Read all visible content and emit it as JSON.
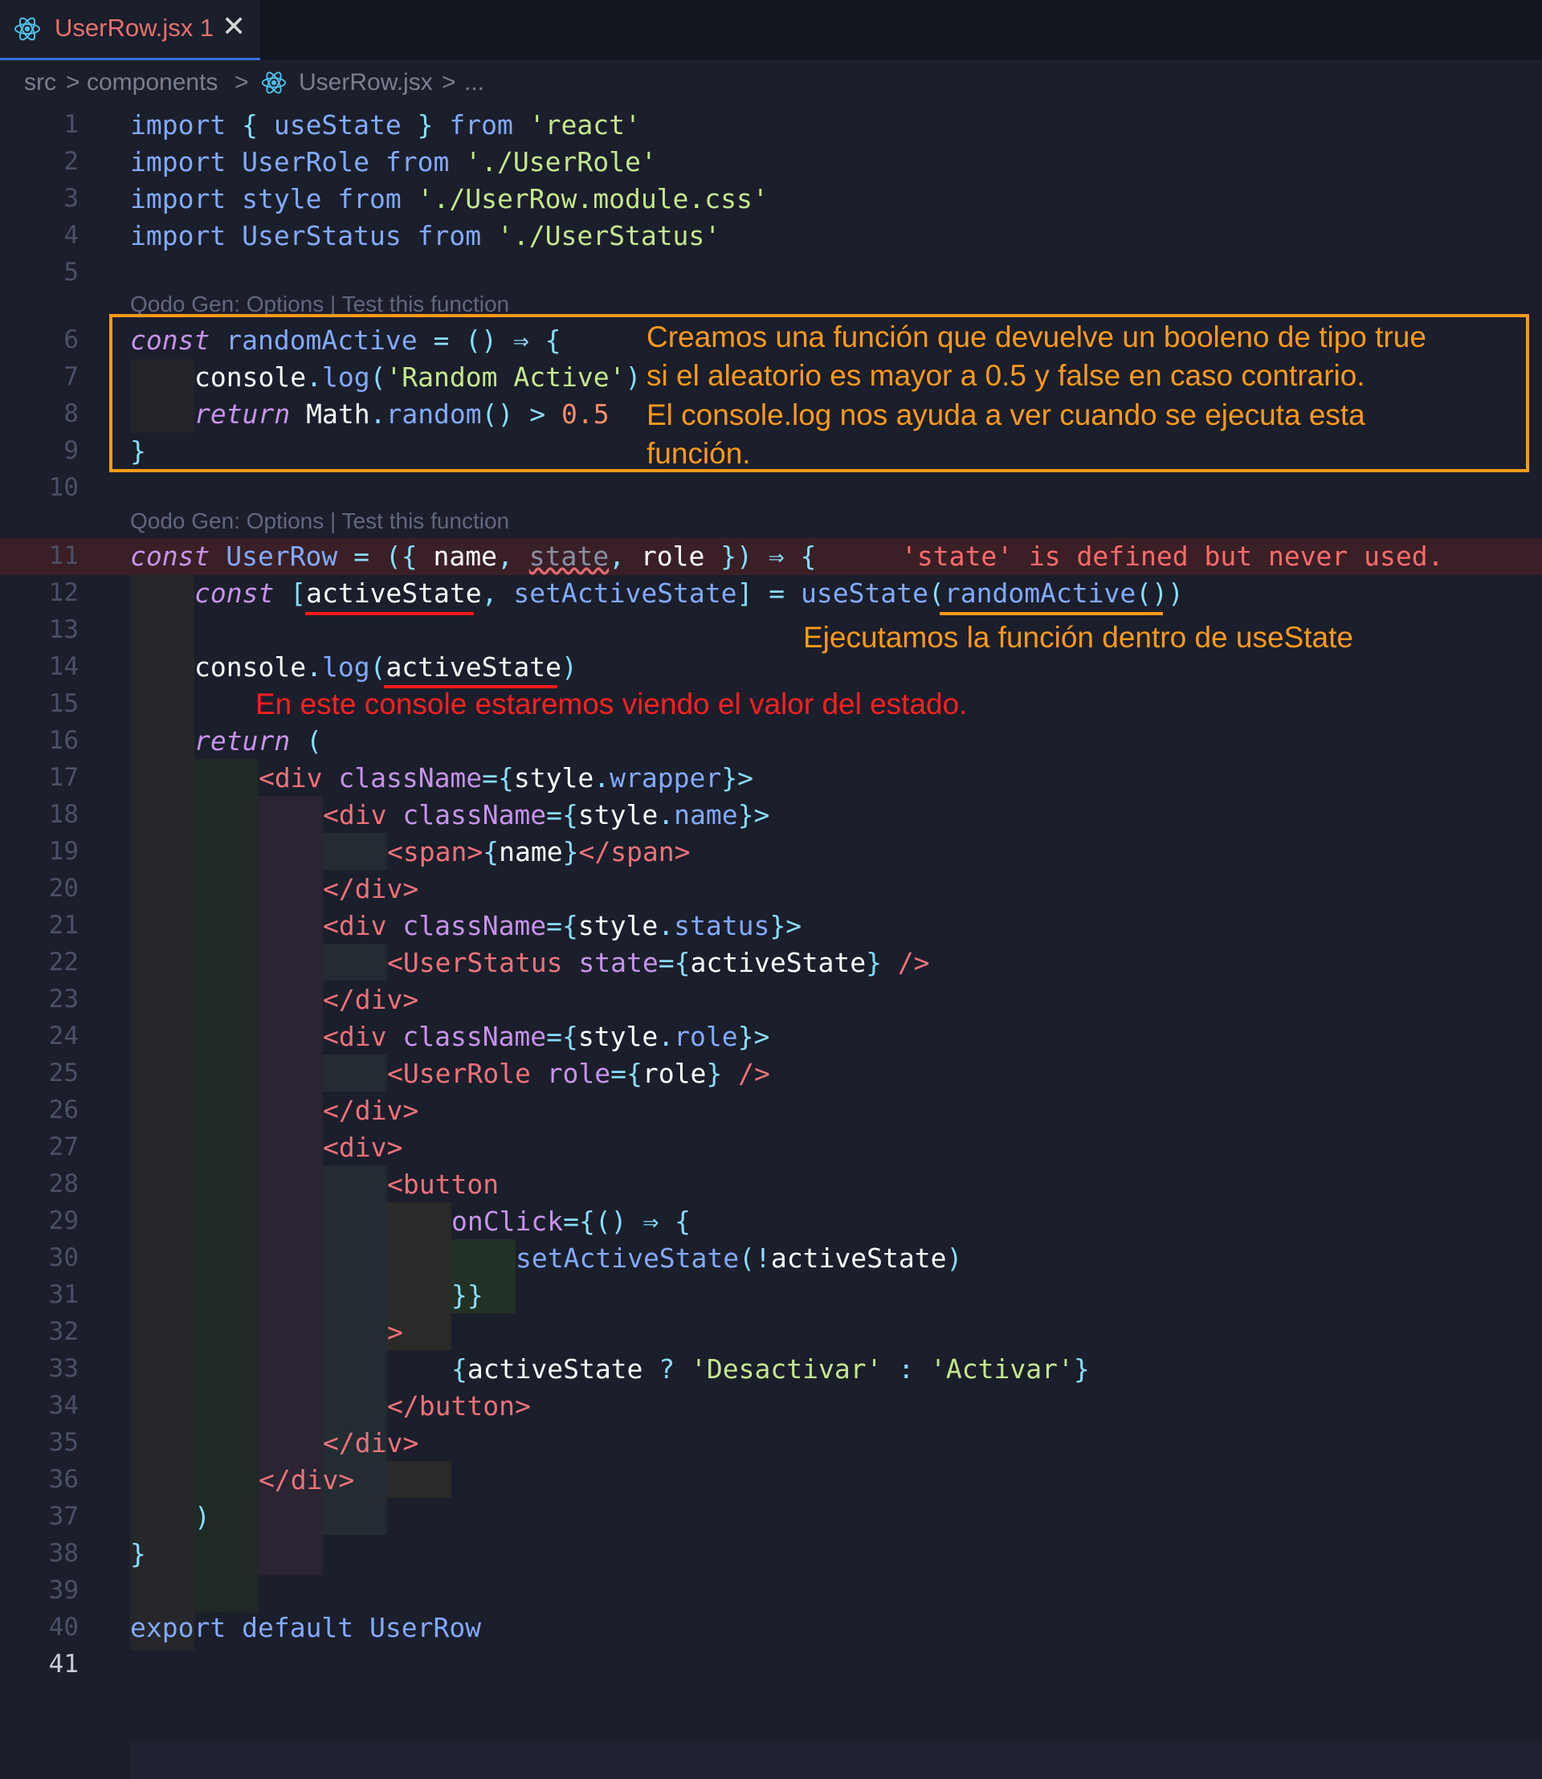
{
  "tab": {
    "title": "UserRow.jsx",
    "problems": "1",
    "close": "✕",
    "icon": "react-icon"
  },
  "breadcrumb": {
    "src": "src",
    "sep1": ">",
    "components": "components",
    "sep2": ">",
    "file": "UserRow.jsx",
    "sep3": ">",
    "more": "..."
  },
  "codelens": {
    "text": "Qodo Gen: Options | Test this function"
  },
  "line_numbers": [
    "1",
    "2",
    "3",
    "4",
    "5",
    "6",
    "7",
    "8",
    "9",
    "10",
    "11",
    "12",
    "13",
    "14",
    "15",
    "16",
    "17",
    "18",
    "19",
    "20",
    "21",
    "22",
    "23",
    "24",
    "25",
    "26",
    "27",
    "28",
    "29",
    "30",
    "31",
    "32",
    "33",
    "34",
    "35",
    "36",
    "37",
    "38",
    "39",
    "40",
    "41"
  ],
  "code": {
    "l1": [
      "import",
      " { ",
      "useState",
      " } ",
      "from",
      " ",
      "'react'"
    ],
    "l2": [
      "import",
      " ",
      "UserRole",
      " ",
      "from",
      " ",
      "'./UserRole'"
    ],
    "l3": [
      "import",
      " ",
      "style",
      " ",
      "from",
      " ",
      "'./UserRow.module.css'"
    ],
    "l4": [
      "import",
      " ",
      "UserStatus",
      " ",
      "from",
      " ",
      "'./UserStatus'"
    ],
    "l6": [
      "const",
      " ",
      "randomActive",
      " = () ⇒ {"
    ],
    "l7": [
      "console",
      ".",
      "log",
      "(",
      "'Random Active'",
      ")"
    ],
    "l8": [
      "return",
      " ",
      "Math",
      ".",
      "random",
      "() > ",
      "0.5"
    ],
    "l9": [
      "}"
    ],
    "l11": [
      "const",
      " ",
      "UserRow",
      " = ({ ",
      "name",
      ", ",
      "state",
      ", ",
      "role",
      " }) ⇒ {"
    ],
    "l11_error": "'state' is defined but never used.",
    "l12": [
      "const",
      " [",
      "activeState",
      ", ",
      "setActiveState",
      "] = ",
      "useState",
      "(",
      "randomActive",
      "()",
      ")"
    ],
    "l14": [
      "console",
      ".",
      "log",
      "(",
      "activeState",
      ")"
    ],
    "l16": [
      "return",
      " ("
    ],
    "l17": [
      "<div",
      " ",
      "className",
      "={",
      "style",
      ".",
      "wrapper",
      "}>"
    ],
    "l18": [
      "<div",
      " ",
      "className",
      "={",
      "style",
      ".",
      "name",
      "}>"
    ],
    "l19": [
      "<span>",
      "{",
      "name",
      "}",
      "</span>"
    ],
    "l20": [
      "</div>"
    ],
    "l21": [
      "<div",
      " ",
      "className",
      "={",
      "style",
      ".",
      "status",
      "}>"
    ],
    "l22": [
      "<UserStatus",
      " ",
      "state",
      "={",
      "activeState",
      "} ",
      "/>"
    ],
    "l23": [
      "</div>"
    ],
    "l24": [
      "<div",
      " ",
      "className",
      "={",
      "style",
      ".",
      "role",
      "}>"
    ],
    "l25": [
      "<UserRole",
      " ",
      "role",
      "={",
      "role",
      "} ",
      "/>"
    ],
    "l26": [
      "</div>"
    ],
    "l27": [
      "<div>"
    ],
    "l28": [
      "<button"
    ],
    "l29": [
      "onClick",
      "={() ⇒ {"
    ],
    "l30": [
      "setActiveState",
      "(",
      "!",
      "activeState",
      ")"
    ],
    "l31": [
      "}}"
    ],
    "l32": [
      ">"
    ],
    "l33": [
      "{",
      "activeState",
      " ? ",
      "'Desactivar'",
      " : ",
      "'Activar'",
      "}"
    ],
    "l34": [
      "</button>"
    ],
    "l35": [
      "</div>"
    ],
    "l36": [
      "</div>"
    ],
    "l37": [
      ")"
    ],
    "l38": [
      "}"
    ],
    "l40": [
      "export",
      " ",
      "default",
      " ",
      "UserRow"
    ]
  },
  "annotations": {
    "box_note_line1": "Creamos una función que devuelve un booleno de tipo true",
    "box_note_line2": "si el aleatorio es mayor a 0.5 y false en caso contrario.",
    "box_note_line3": "El console.log nos ayuda a ver cuando se ejecuta esta",
    "box_note_line4": "función.",
    "use_state_note": "Ejecutamos la función dentro de useState",
    "console_note": "En este console estaremos viendo el valor del estado."
  },
  "colors": {
    "background": "#1b1e2b",
    "keyword": "#c792ea",
    "function": "#82aaff",
    "string": "#c3e88d",
    "tag": "#f07178",
    "orange": "#ff9a1a",
    "red": "#ff2020"
  }
}
